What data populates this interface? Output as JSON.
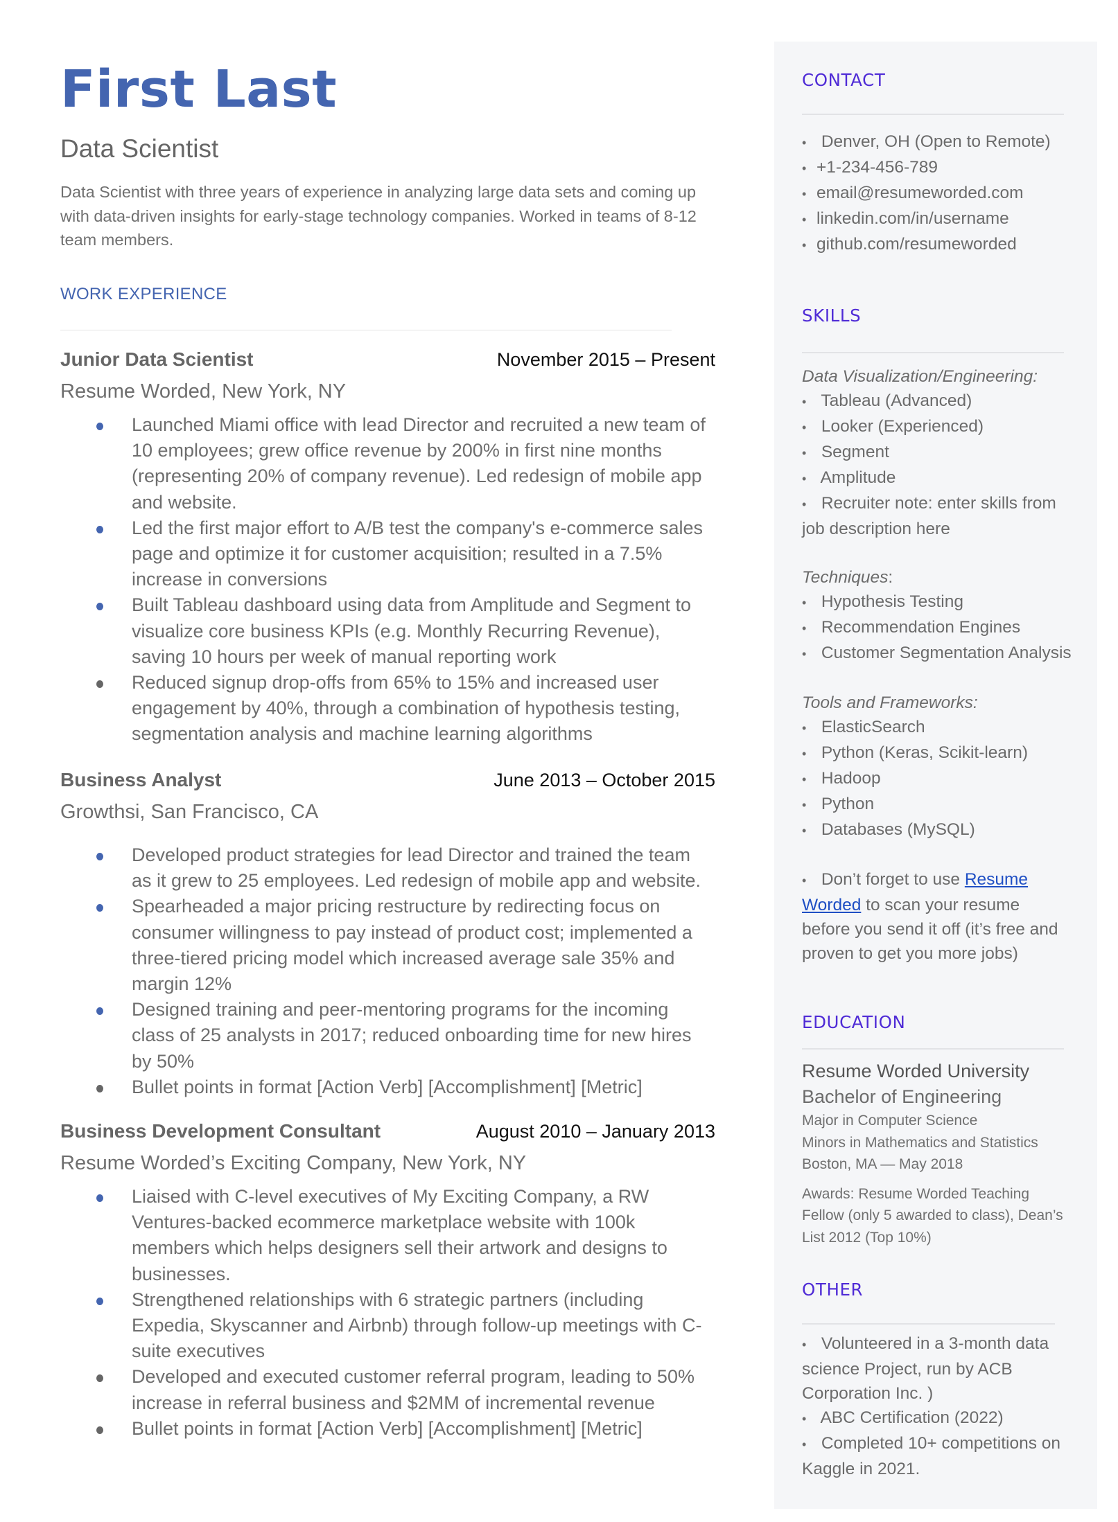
{
  "header": {
    "name": "First Last",
    "role": "Data Scientist",
    "summary": "Data Scientist with three years of experience in analyzing large data sets and coming up with data-driven insights for early-stage technology companies. Worked in teams of 8-12 team members."
  },
  "colors": {
    "name": "#4465b0",
    "sidebar_heading": "#4f2bd6",
    "link": "#1f4fc4",
    "sidebar_bg": "#f5f6f8"
  },
  "work": {
    "heading": "WORK EXPERIENCE",
    "jobs": [
      {
        "title": "Junior Data Scientist",
        "dates": "November 2015 – Present",
        "company": "Resume Worded, New York, NY",
        "bullets": [
          "Launched Miami office with lead Director and recruited a new team of 10 employees; grew office revenue by 200% in first nine months (representing 20% of company revenue). Led redesign of mobile app and website.",
          "Led the first major effort to A/B test the company's e-commerce sales page and optimize it for customer acquisition; resulted in a 7.5% increase in conversions",
          "Built Tableau dashboard using data from Amplitude and Segment to visualize core business KPIs (e.g. Monthly Recurring Revenue), saving 10 hours per week of manual reporting work",
          "Reduced signup drop-offs from 65% to 15% and increased user engagement by 40%, through a combination of hypothesis testing, segmentation analysis and machine learning algorithms"
        ]
      },
      {
        "title": "Business Analyst",
        "dates": "June 2013 – October 2015",
        "company": "Growthsi, San Francisco, CA",
        "bullets": [
          "Developed product strategies for lead Director and trained the team as it grew to 25 employees. Led redesign of mobile app and website.",
          "Spearheaded a major pricing restructure by redirecting focus on consumer willingness to pay instead of product cost; implemented a three-tiered pricing model which increased average sale 35% and margin 12%",
          "Designed training and peer-mentoring programs for the incoming class of 25 analysts in 2017; reduced onboarding time for new hires by 50%",
          "Bullet points in format [Action Verb] [Accomplishment] [Metric]"
        ]
      },
      {
        "title": "Business Development Consultant",
        "dates": "August 2010 – January 2013",
        "company": "Resume Worded’s Exciting Company, New York, NY",
        "bullets": [
          "Liaised with C-level executives of My Exciting Company, a RW Ventures-backed ecommerce marketplace website with 100k members which helps designers sell their artwork and designs to businesses.",
          "Strengthened relationships with 6 strategic partners (including Expedia, Skyscanner and Airbnb) through follow-up meetings with C-suite executives",
          "Developed and executed customer referral program, leading to 50% increase in referral business and $2MM of incremental revenue",
          "Bullet points in format [Action Verb] [Accomplishment] [Metric]"
        ]
      }
    ]
  },
  "sidebar": {
    "contact": {
      "heading": "CONTACT",
      "items": [
        "Denver, OH (Open to Remote)",
        "+1-234-456-789",
        "email@resumeworded.com",
        "linkedin.com/in/username",
        "github.com/resumeworded"
      ]
    },
    "skills": {
      "heading": "SKILLS",
      "groups": [
        {
          "label": "Data Visualization/Engineering:",
          "items": [
            "Tableau (Advanced)",
            "Looker (Experienced)",
            "Segment",
            "Amplitude",
            "Recruiter note: enter skills from",
            "job description here"
          ]
        },
        {
          "label": "Techniques",
          "label_suffix": ":",
          "items": [
            "Hypothesis Testing",
            "Recommendation Engines",
            "Customer Segmentation Analysis"
          ]
        },
        {
          "label": "Tools and Frameworks:",
          "items": [
            "ElasticSearch",
            "Python (Keras, Scikit-learn)",
            "Hadoop",
            "Python",
            "Databases (MySQL)"
          ]
        }
      ],
      "tip": {
        "prefix": "Don’t forget to use ",
        "link": "Resume Worded",
        "suffix": " to scan your resume before you send it off (it’s free and proven to get you more jobs)"
      }
    },
    "education": {
      "heading": "EDUCATION",
      "school": "Resume Worded University",
      "degree": "Bachelor of Engineering",
      "major": "Major in Computer Science",
      "minors": "Minors in Mathematics and Statistics",
      "location_date": "Boston, MA — May 2018",
      "awards": "Awards: Resume Worded Teaching Fellow (only 5 awarded to class), Dean’s List 2012 (Top 10%)"
    },
    "other": {
      "heading": "OTHER",
      "items": [
        "Volunteered in a 3-month data science Project, run by ACB Corporation Inc. )",
        "ABC Certification (2022)",
        "Completed 10+ competitions on Kaggle in 2021."
      ]
    }
  }
}
